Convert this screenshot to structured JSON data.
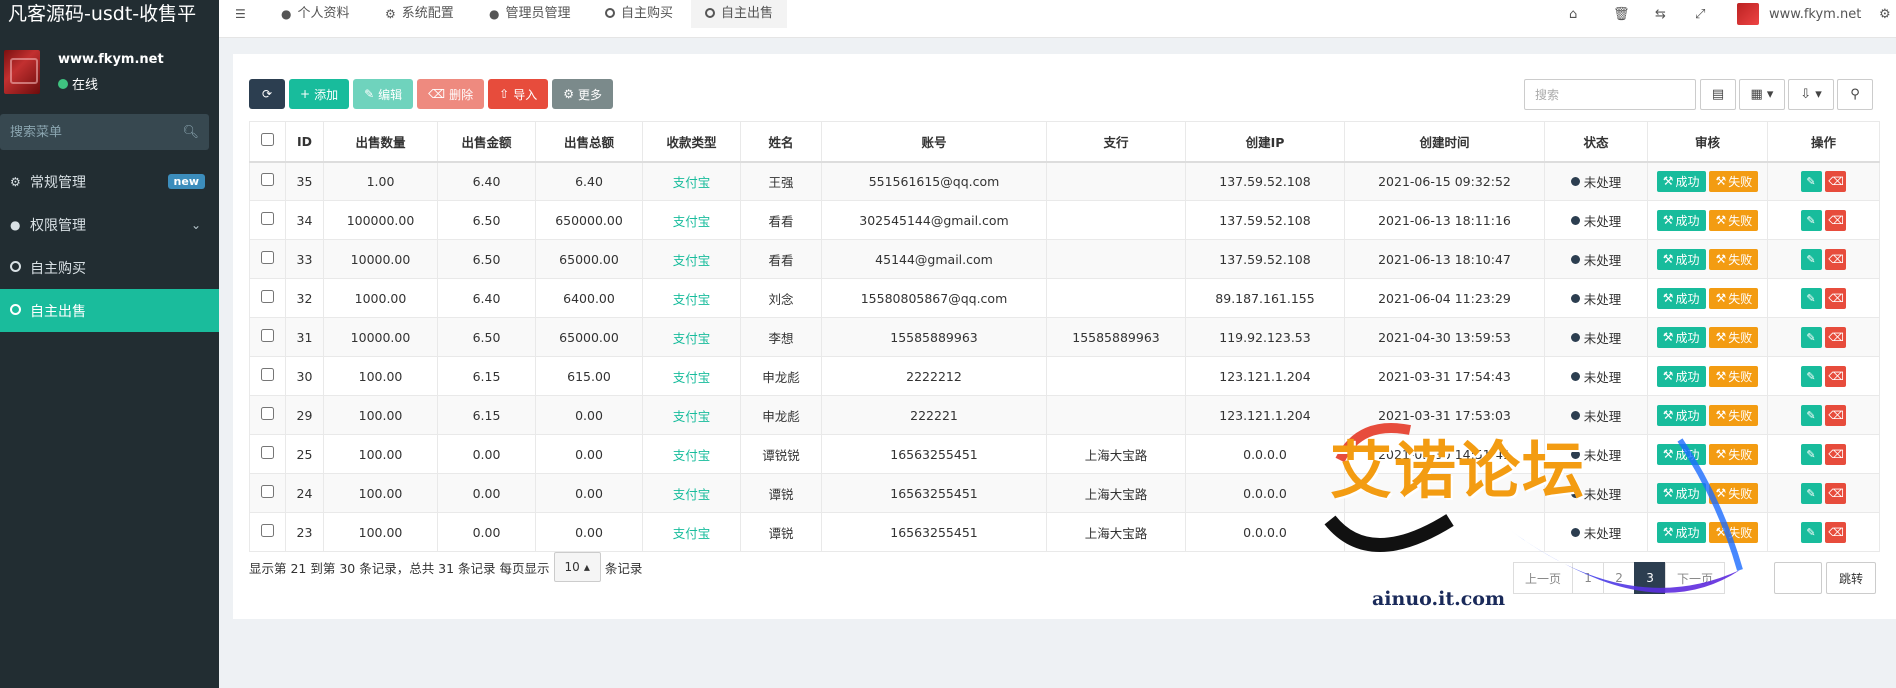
{
  "sidebar": {
    "app_title": "凡客源码-usdt-收售平",
    "user_name": "www.fkym.net",
    "user_status": "在线",
    "search_placeholder": "搜索菜单",
    "items": [
      {
        "label": "常规管理",
        "icon": "cogs-icon",
        "badge": "new"
      },
      {
        "label": "权限管理",
        "icon": "users-icon"
      },
      {
        "label": "自主购买",
        "icon": "circle-o-icon"
      },
      {
        "label": "自主出售",
        "icon": "circle-o-icon",
        "active": true
      }
    ]
  },
  "topnav": {
    "tabs": [
      {
        "label": "个人资料",
        "icon": "user-icon"
      },
      {
        "label": "系统配置",
        "icon": "gear-icon"
      },
      {
        "label": "管理员管理",
        "icon": "user-icon"
      },
      {
        "label": "自主购买",
        "icon": "circle-o-icon"
      },
      {
        "label": "自主出售",
        "icon": "circle-o-icon",
        "active": true
      }
    ],
    "site": "www.fkym.net"
  },
  "toolbar": {
    "add": "添加",
    "edit": "编辑",
    "delete": "删除",
    "import": "导入",
    "more": "更多",
    "search_placeholder": "搜索"
  },
  "table": {
    "headers": [
      "ID",
      "出售数量",
      "出售金额",
      "出售总额",
      "收款类型",
      "姓名",
      "账号",
      "支行",
      "创建IP",
      "创建时间",
      "状态",
      "审核",
      "操作"
    ],
    "approve_label": "成功",
    "reject_label": "失败",
    "rows": [
      {
        "id": "35",
        "qty": "1.00",
        "price": "6.40",
        "total": "6.40",
        "type": "支付宝",
        "name": "王强",
        "account": "551561615@qq.com",
        "branch": "",
        "ip": "137.59.52.108",
        "time": "2021-06-15 09:32:52",
        "status": "未处理"
      },
      {
        "id": "34",
        "qty": "100000.00",
        "price": "6.50",
        "total": "650000.00",
        "type": "支付宝",
        "name": "看看",
        "account": "302545144@gmail.com",
        "branch": "",
        "ip": "137.59.52.108",
        "time": "2021-06-13 18:11:16",
        "status": "未处理"
      },
      {
        "id": "33",
        "qty": "10000.00",
        "price": "6.50",
        "total": "65000.00",
        "type": "支付宝",
        "name": "看看",
        "account": "45144@gmail.com",
        "branch": "",
        "ip": "137.59.52.108",
        "time": "2021-06-13 18:10:47",
        "status": "未处理"
      },
      {
        "id": "32",
        "qty": "1000.00",
        "price": "6.40",
        "total": "6400.00",
        "type": "支付宝",
        "name": "刘念",
        "account": "15580805867@qq.com",
        "branch": "",
        "ip": "89.187.161.155",
        "time": "2021-06-04 11:23:29",
        "status": "未处理"
      },
      {
        "id": "31",
        "qty": "10000.00",
        "price": "6.50",
        "total": "65000.00",
        "type": "支付宝",
        "name": "李想",
        "account": "15585889963",
        "branch": "15585889963",
        "ip": "119.92.123.53",
        "time": "2021-04-30 13:59:53",
        "status": "未处理"
      },
      {
        "id": "30",
        "qty": "100.00",
        "price": "6.15",
        "total": "615.00",
        "type": "支付宝",
        "name": "申龙彪",
        "account": "2222212",
        "branch": "",
        "ip": "123.121.1.204",
        "time": "2021-03-31 17:54:43",
        "status": "未处理"
      },
      {
        "id": "29",
        "qty": "100.00",
        "price": "6.15",
        "total": "0.00",
        "type": "支付宝",
        "name": "申龙彪",
        "account": "222221",
        "branch": "",
        "ip": "123.121.1.204",
        "time": "2021-03-31 17:53:03",
        "status": "未处理"
      },
      {
        "id": "25",
        "qty": "100.00",
        "price": "0.00",
        "total": "0.00",
        "type": "支付宝",
        "name": "谭锐锐",
        "account": "16563255451",
        "branch": "上海大宝路",
        "ip": "0.0.0.0",
        "time": "2021-03-30 14:51:41",
        "status": "未处理"
      },
      {
        "id": "24",
        "qty": "100.00",
        "price": "0.00",
        "total": "0.00",
        "type": "支付宝",
        "name": "谭锐",
        "account": "16563255451",
        "branch": "上海大宝路",
        "ip": "0.0.0.0",
        "time": "",
        "status": "未处理"
      },
      {
        "id": "23",
        "qty": "100.00",
        "price": "0.00",
        "total": "0.00",
        "type": "支付宝",
        "name": "谭锐",
        "account": "16563255451",
        "branch": "上海大宝路",
        "ip": "0.0.0.0",
        "time": "",
        "status": "未处理"
      }
    ]
  },
  "footer": {
    "info_prefix": "显示第 21 到第 30 条记录，总共 31 条记录 每页显示",
    "page_size": "10",
    "info_suffix": "条记录",
    "prev": "上一页",
    "pages": [
      "1",
      "2",
      "3"
    ],
    "current_page": "3",
    "next": "下一页",
    "jump": "跳转"
  },
  "watermark": {
    "text": "艾诺论坛",
    "url": "ainuo.it.com"
  },
  "colors": {
    "sidebar_bg": "#222d32",
    "accent": "#18bc9c",
    "danger": "#e74c3c",
    "warning": "#f39c12",
    "dark": "#2c3e50"
  }
}
